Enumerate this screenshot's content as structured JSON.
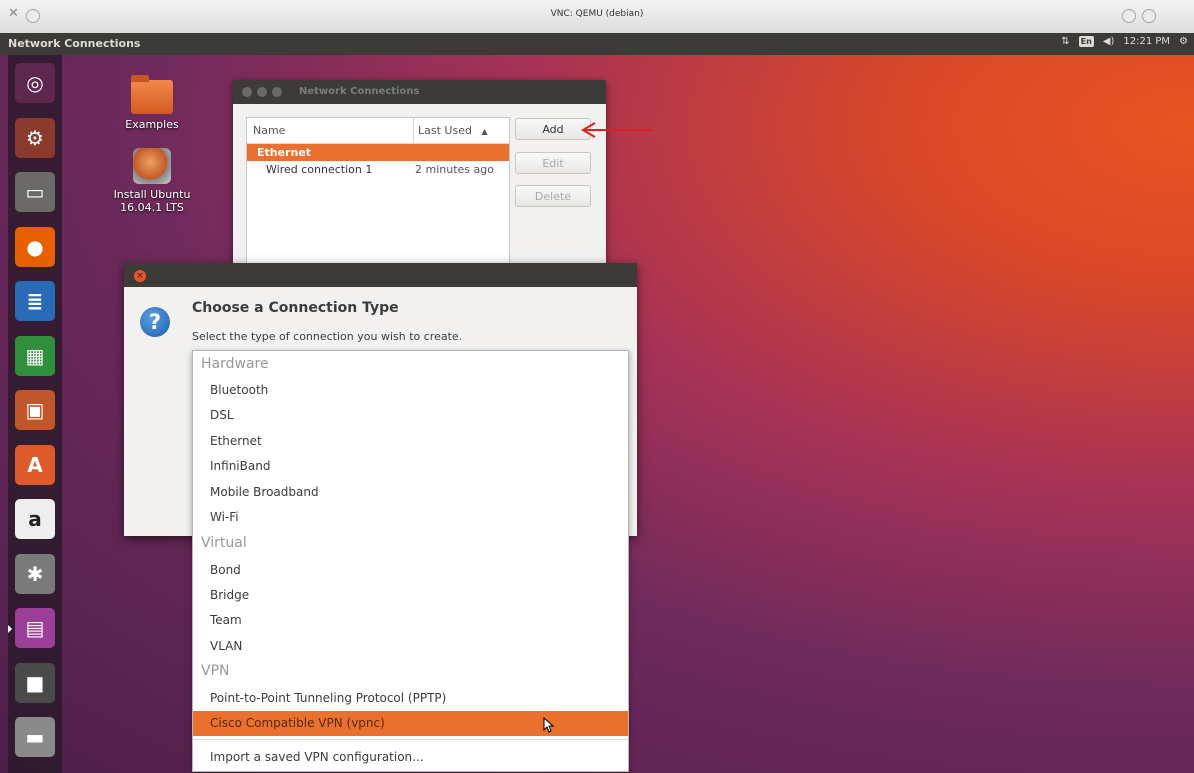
{
  "vnc": {
    "title": "VNC: QEMU (debian)",
    "close_glyph": "✕"
  },
  "top_panel": {
    "title": "Network Connections",
    "indicators": {
      "network": "⇅",
      "keyboard": "En",
      "volume": "◀)",
      "time": "12:21 PM",
      "gear": "⚙"
    }
  },
  "launcher": [
    {
      "name": "dash-icon",
      "glyph": "◎",
      "bg": "#5e2750"
    },
    {
      "name": "install-ubuntu-launcher-icon",
      "glyph": "⚙",
      "bg": "#8a3b2d"
    },
    {
      "name": "files-icon",
      "glyph": "▭",
      "bg": "#6b6a66"
    },
    {
      "name": "firefox-icon",
      "glyph": "●",
      "bg": "#e66000"
    },
    {
      "name": "writer-icon",
      "glyph": "≣",
      "bg": "#2a6bb7"
    },
    {
      "name": "calc-icon",
      "glyph": "▦",
      "bg": "#2f8f3a"
    },
    {
      "name": "impress-icon",
      "glyph": "▣",
      "bg": "#c1562a"
    },
    {
      "name": "software-center-icon",
      "glyph": "A",
      "bg": "#dd5a2b"
    },
    {
      "name": "amazon-icon",
      "glyph": "a",
      "bg": "#eeeeee"
    },
    {
      "name": "system-settings-icon",
      "glyph": "✱",
      "bg": "#7a7a7a"
    },
    {
      "name": "network-connections-launcher-icon",
      "glyph": "▤",
      "bg": "#9b3e97"
    },
    {
      "name": "save-icon",
      "glyph": "■",
      "bg": "#4a4a4a"
    },
    {
      "name": "drive-icon",
      "glyph": "▬",
      "bg": "#8a8a8a"
    }
  ],
  "desktop": {
    "examples_label": "Examples",
    "install_label_1": "Install Ubuntu",
    "install_label_2": "16.04.1 LTS"
  },
  "nc_window": {
    "title": "Network Connections",
    "col_name": "Name",
    "col_last_used": "Last Used",
    "sort_arrow": "▲",
    "group": "Ethernet",
    "connection_name": "Wired connection 1",
    "connection_last_used": "2 minutes ago",
    "add_label": "Add",
    "edit_label": "Edit",
    "delete_label": "Delete"
  },
  "ct_dialog": {
    "close_glyph": "×",
    "question_glyph": "?",
    "heading": "Choose a Connection Type",
    "subtitle": "Select the type of connection you wish to create."
  },
  "connection_types": {
    "hardware_header": "Hardware",
    "bluetooth": "Bluetooth",
    "dsl": "DSL",
    "ethernet": "Ethernet",
    "infiniband": "InfiniBand",
    "mobile_broadband": "Mobile Broadband",
    "wifi": "Wi-Fi",
    "virtual_header": "Virtual",
    "bond": "Bond",
    "bridge": "Bridge",
    "team": "Team",
    "vlan": "VLAN",
    "vpn_header": "VPN",
    "pptp": "Point-to-Point Tunneling Protocol (PPTP)",
    "vpnc": "Cisco Compatible VPN (vpnc)",
    "import": "Import a saved VPN configuration..."
  },
  "colors": {
    "accent": "#e9702e",
    "panel": "#3c3b37",
    "arrow": "#e02020"
  }
}
